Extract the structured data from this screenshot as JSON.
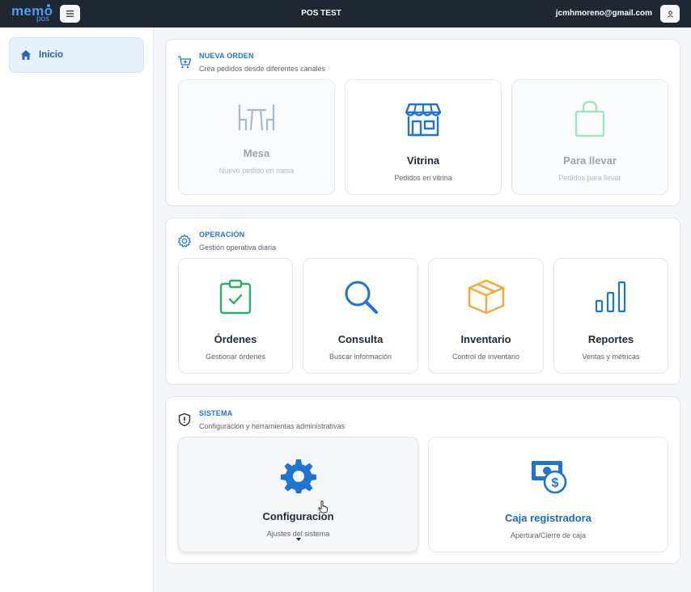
{
  "topbar": {
    "logo_main": "memo",
    "logo_sub": "pos",
    "menu_icon": "hamburger-icon",
    "title": "POS TEST",
    "user_email": "jcmhmoreno@gmail.com",
    "user_icon": "user-icon"
  },
  "sidebar": {
    "items": [
      {
        "label": "Inicio",
        "icon": "home-icon",
        "active": true
      }
    ]
  },
  "sections": {
    "nueva_orden": {
      "title": "NUEVA ORDEN",
      "subtitle": "Crea pedidos desde diferentes canales",
      "icon": "cart-plus-icon",
      "cards": [
        {
          "title": "Mesa",
          "subtitle": "Nuevo pedido en mesa",
          "icon": "table-chairs-icon",
          "enabled": false
        },
        {
          "title": "Vitrina",
          "subtitle": "Pedidos en vitrina",
          "icon": "storefront-icon",
          "enabled": true
        },
        {
          "title": "Para llevar",
          "subtitle": "Pedidos para llevar",
          "icon": "shopping-bag-icon",
          "enabled": false
        }
      ]
    },
    "operacion": {
      "title": "OPERACIÓN",
      "subtitle": "Gestión operativa diaria",
      "icon": "gear-icon",
      "cards": [
        {
          "title": "Órdenes",
          "subtitle": "Gestionar órdenes",
          "icon": "clipboard-check-icon"
        },
        {
          "title": "Consulta",
          "subtitle": "Buscar información",
          "icon": "search-icon"
        },
        {
          "title": "Inventario",
          "subtitle": "Control de inventario",
          "icon": "box-icon"
        },
        {
          "title": "Reportes",
          "subtitle": "Ventas y métricas",
          "icon": "bar-chart-icon"
        }
      ]
    },
    "sistema": {
      "title": "SISTEMA",
      "subtitle": "Configuración y herramientas administrativas",
      "icon": "shield-icon",
      "cards": [
        {
          "title": "Configuracion",
          "subtitle": "Ajustes del sistema",
          "icon": "gear-icon"
        },
        {
          "title": "Caja registradora",
          "subtitle": "Apertura/Cierre de caja",
          "icon": "cash-register-icon"
        }
      ]
    }
  },
  "colors": {
    "topbar": "#1f2733",
    "accent_blue": "#1f74d1",
    "green": "#2fae62",
    "orange": "#f4a93b",
    "disabled": "#b4bbc4"
  }
}
